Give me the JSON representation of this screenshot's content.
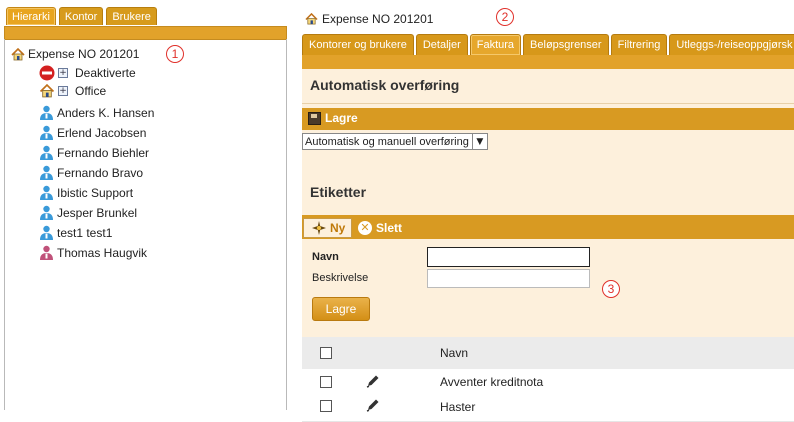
{
  "left": {
    "tabs": [
      {
        "label": "Hierarki",
        "active": true
      },
      {
        "label": "Kontor",
        "active": false
      },
      {
        "label": "Brukere",
        "active": false
      }
    ],
    "tree": {
      "root": "Expense NO 201201",
      "groups": [
        {
          "label": "Deaktiverte",
          "icon": "no-entry-icon"
        },
        {
          "label": "Office",
          "icon": "house-icon"
        }
      ],
      "users": [
        {
          "name": "Anders K. Hansen",
          "gender": "male"
        },
        {
          "name": "Erlend Jacobsen",
          "gender": "male"
        },
        {
          "name": "Fernando Biehler",
          "gender": "male"
        },
        {
          "name": "Fernando Bravo",
          "gender": "male"
        },
        {
          "name": "Ibistic Support",
          "gender": "male"
        },
        {
          "name": "Jesper Brunkel",
          "gender": "male"
        },
        {
          "name": "test1 test1",
          "gender": "male"
        },
        {
          "name": "Thomas Haugvik",
          "gender": "female"
        }
      ]
    }
  },
  "badges": {
    "one": "1",
    "two": "2",
    "three": "3"
  },
  "breadcrumb": "Expense NO 201201",
  "tabs": [
    {
      "label": "Kontorer og brukere",
      "active": false
    },
    {
      "label": "Detaljer",
      "active": false
    },
    {
      "label": "Faktura",
      "active": true
    },
    {
      "label": "Beløpsgrenser",
      "active": false
    },
    {
      "label": "Filtrering",
      "active": false
    },
    {
      "label": "Utleggs-/reiseoppgjørsk",
      "active": false
    }
  ],
  "auto_section": {
    "title": "Automatisk overføring",
    "save_label": "Lagre",
    "select_value": "Automatisk og manuell overføring"
  },
  "labels_section": {
    "title": "Etiketter",
    "new_label": "Ny",
    "delete_label": "Slett",
    "name_label": "Navn",
    "name_value": "",
    "desc_label": "Beskrivelse",
    "desc_value": "",
    "save_label": "Lagre"
  },
  "table": {
    "column_name": "Navn",
    "rows": [
      "Avventer kreditnota",
      "Haster"
    ]
  },
  "colors": {
    "accent": "#e2a22a",
    "panel": "#fdf0dc",
    "badge": "#e0302a"
  }
}
